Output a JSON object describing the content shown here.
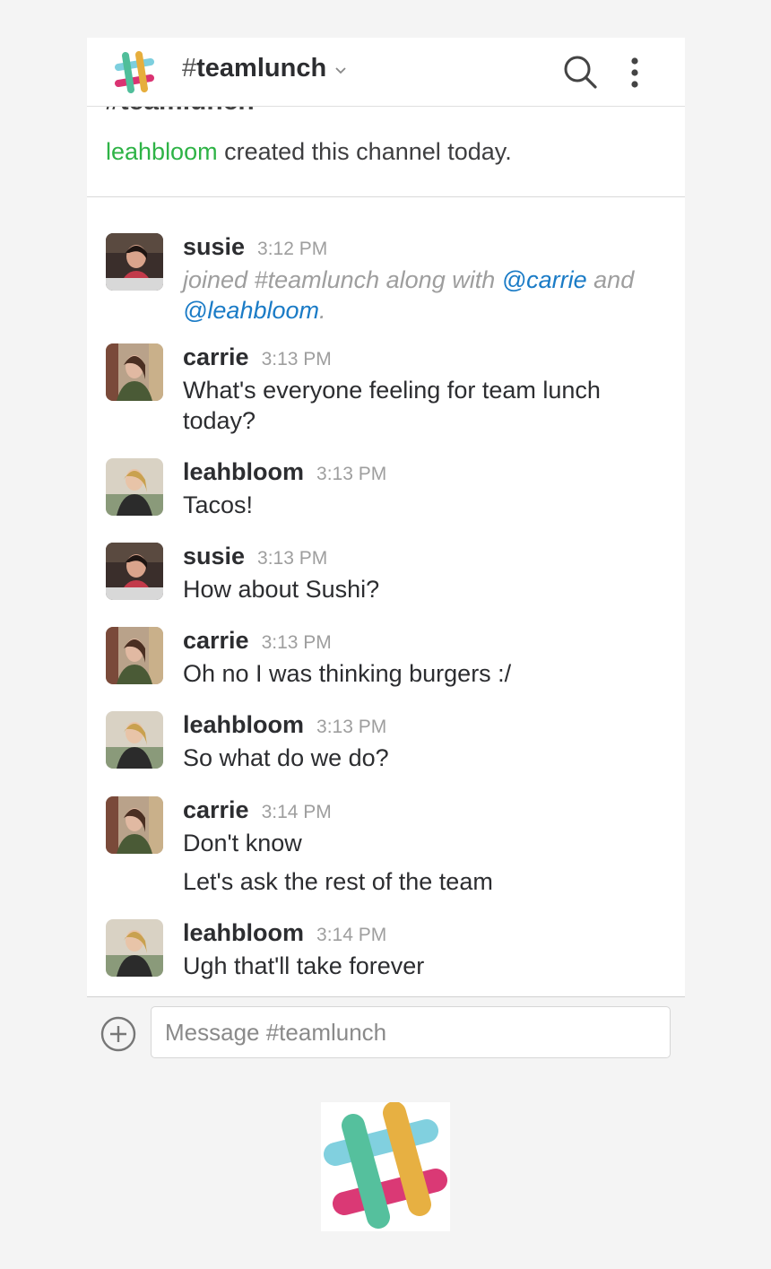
{
  "header": {
    "channel_hash": "#",
    "channel_name": "teamlunch"
  },
  "channel_intro": {
    "ghost_title": "#teamlunch",
    "creator": "leahbloom",
    "created_text": " created this channel today."
  },
  "messages": [
    {
      "author": "susie",
      "time": "3:12 PM",
      "parts": [
        "joined #teamlunch along with ",
        "@carrie",
        " and ",
        "@leahbloom",
        "."
      ]
    },
    {
      "author": "carrie",
      "time": "3:13 PM",
      "text": "What's everyone feeling for team lunch today?"
    },
    {
      "author": "leahbloom",
      "time": "3:13 PM",
      "text": "Tacos!"
    },
    {
      "author": "susie",
      "time": "3:13 PM",
      "text": "How about Sushi?"
    },
    {
      "author": "carrie",
      "time": "3:13 PM",
      "text": "Oh no I was thinking burgers :/"
    },
    {
      "author": "leahbloom",
      "time": "3:13 PM",
      "text": "So what do we do?"
    },
    {
      "author": "carrie",
      "time": "3:14 PM",
      "text": "Don't know",
      "text2": "Let's ask the rest of the team"
    },
    {
      "author": "leahbloom",
      "time": "3:14 PM",
      "text": "Ugh that'll take forever"
    }
  ],
  "composer": {
    "placeholder": "Message #teamlunch"
  },
  "colors": {
    "mention": "#1a7bc6",
    "creator_name": "#2eb346",
    "logo_teal": "#70cadb",
    "logo_green": "#3eb890",
    "logo_yellow": "#e4a629",
    "logo_red": "#d61e63"
  },
  "icons": {
    "logo": "slack-hash-logo",
    "dropdown": "chevron-down-icon",
    "search": "search-icon",
    "more": "more-vertical-icon",
    "attach": "plus-circle-icon"
  }
}
